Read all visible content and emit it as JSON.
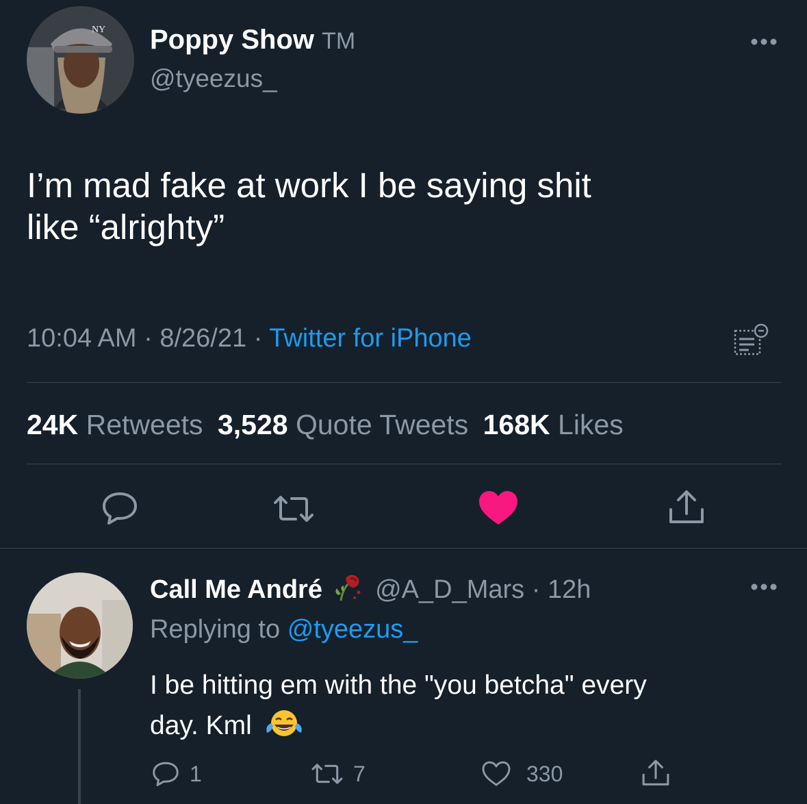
{
  "tweet": {
    "author_name": "Poppy Show",
    "author_suffix": "TM",
    "author_handle": "@tyeezus_",
    "text_line1": "I’m mad fake at work I be saying shit",
    "text_line2": "like “alrighty”",
    "time": "10:04 AM",
    "date": "8/26/21",
    "sep": "·",
    "source": "Twitter for iPhone"
  },
  "stats": {
    "retweets_count": "24K",
    "retweets_label": "Retweets",
    "quotes_count": "3,528",
    "quotes_label": "Quote Tweets",
    "likes_count": "168K",
    "likes_label": "Likes"
  },
  "reply": {
    "author_name": "Call Me André",
    "author_handle": "@A_D_Mars",
    "sep": "·",
    "time": "12h",
    "replying_prefix": "Replying to",
    "replying_handle": "@tyeezus_",
    "text_line1": "I be hitting em with the \"you betcha\" every",
    "text_line2": "day. Kml",
    "reply_count": "1",
    "retweet_count": "7",
    "like_count": "330"
  },
  "colors": {
    "background": "#15202b",
    "accent": "#1d9bf0",
    "like": "#f91880",
    "muted": "#8b98a5"
  },
  "icons": {
    "more": "more-dots-icon",
    "reply": "reply-bubble-icon",
    "retweet": "retweet-icon",
    "like": "heart-icon",
    "share": "share-icon",
    "analytics": "analytics-icon",
    "emoji_rose": "wilted-rose-emoji",
    "emoji_laugh": "tears-of-joy-emoji"
  }
}
